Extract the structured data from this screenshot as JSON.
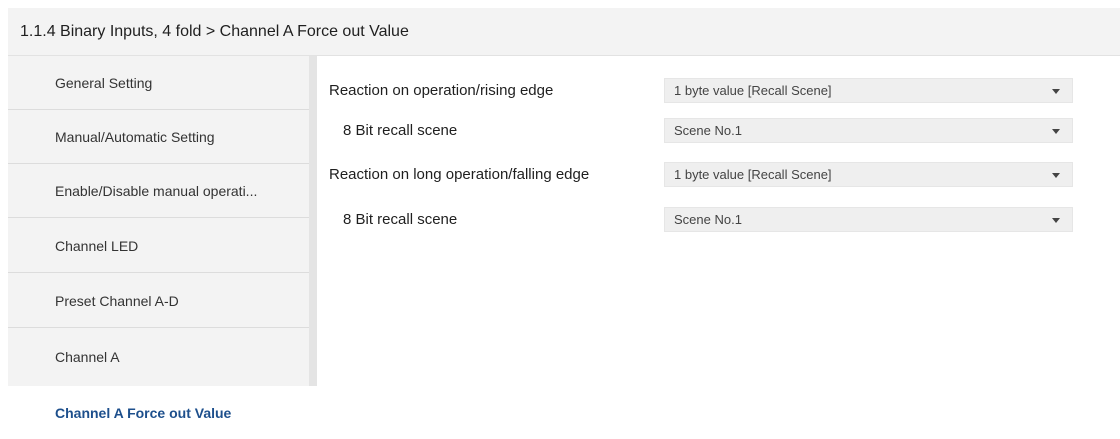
{
  "header": {
    "title": "1.1.4 Binary Inputs, 4 fold > Channel A Force out Value"
  },
  "sidebar": {
    "items": [
      {
        "label": "General Setting",
        "active": false
      },
      {
        "label": "Manual/Automatic Setting",
        "active": false
      },
      {
        "label": "Enable/Disable manual operati...",
        "active": false
      },
      {
        "label": "Channel LED",
        "active": false
      },
      {
        "label": "Preset Channel A-D",
        "active": false
      },
      {
        "label": "Channel A",
        "active": false
      },
      {
        "label": "Channel A Force out Value",
        "active": true
      }
    ]
  },
  "parameters": [
    {
      "label": "Reaction on operation/rising edge",
      "value": "1 byte value [Recall Scene]"
    },
    {
      "label": "8 Bit recall scene",
      "value": "Scene No.1"
    },
    {
      "label": "Reaction on long operation/falling edge",
      "value": "1 byte value [Recall Scene]"
    },
    {
      "label": "8 Bit recall scene",
      "value": "Scene No.1"
    }
  ],
  "colors": {
    "panel_bg": "#f3f3f3",
    "active_item": "#1d4f8c",
    "dropdown_bg": "#efefef"
  },
  "icons": {
    "dropdown": "caret-down-icon"
  }
}
